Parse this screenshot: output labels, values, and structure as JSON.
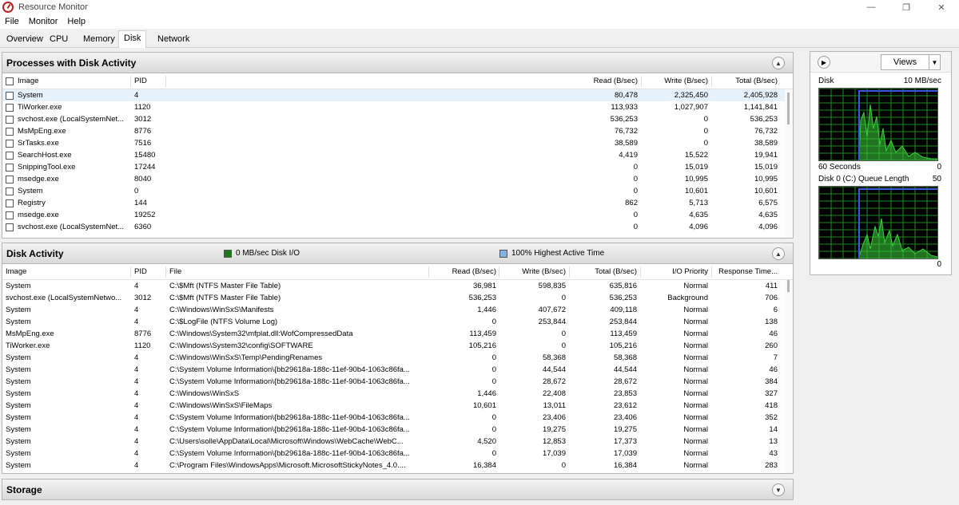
{
  "window": {
    "title": "Resource Monitor",
    "minimize_icon": "minimize-icon",
    "maximize_icon": "restore-icon"
  },
  "menu": {
    "file": "File",
    "monitor": "Monitor",
    "help": "Help"
  },
  "tabs": {
    "overview": "Overview",
    "cpu": "CPU",
    "memory": "Memory",
    "disk": "Disk",
    "network": "Network"
  },
  "processes": {
    "title": "Processes with Disk Activity",
    "headers": {
      "image": "Image",
      "pid": "PID",
      "read": "Read (B/sec)",
      "write": "Write (B/sec)",
      "total": "Total (B/sec)"
    },
    "rows": [
      {
        "image": "System",
        "pid": "4",
        "read": "80,478",
        "write": "2,325,450",
        "total": "2,405,928"
      },
      {
        "image": "TiWorker.exe",
        "pid": "1120",
        "read": "113,933",
        "write": "1,027,907",
        "total": "1,141,841"
      },
      {
        "image": "svchost.exe (LocalSystemNet...",
        "pid": "3012",
        "read": "536,253",
        "write": "0",
        "total": "536,253"
      },
      {
        "image": "MsMpEng.exe",
        "pid": "8776",
        "read": "76,732",
        "write": "0",
        "total": "76,732"
      },
      {
        "image": "SrTasks.exe",
        "pid": "7516",
        "read": "38,589",
        "write": "0",
        "total": "38,589"
      },
      {
        "image": "SearchHost.exe",
        "pid": "15480",
        "read": "4,419",
        "write": "15,522",
        "total": "19,941"
      },
      {
        "image": "SnippingTool.exe",
        "pid": "17244",
        "read": "0",
        "write": "15,019",
        "total": "15,019"
      },
      {
        "image": "msedge.exe",
        "pid": "8040",
        "read": "0",
        "write": "10,995",
        "total": "10,995"
      },
      {
        "image": "System",
        "pid": "0",
        "read": "0",
        "write": "10,601",
        "total": "10,601"
      },
      {
        "image": "Registry",
        "pid": "144",
        "read": "862",
        "write": "5,713",
        "total": "6,575"
      },
      {
        "image": "msedge.exe",
        "pid": "19252",
        "read": "0",
        "write": "4,635",
        "total": "4,635"
      },
      {
        "image": "svchost.exe (LocalSystemNet...",
        "pid": "6360",
        "read": "0",
        "write": "4,096",
        "total": "4,096"
      }
    ]
  },
  "disk_activity": {
    "title": "Disk Activity",
    "legend_io": "0 MB/sec Disk I/O",
    "legend_active": "100% Highest Active Time",
    "headers": {
      "image": "Image",
      "pid": "PID",
      "file": "File",
      "read": "Read (B/sec)",
      "write": "Write (B/sec)",
      "total": "Total (B/sec)",
      "priority": "I/O Priority",
      "response": "Response Time..."
    },
    "rows": [
      {
        "image": "System",
        "pid": "4",
        "file": "C:\\$Mft (NTFS Master File Table)",
        "read": "36,981",
        "write": "598,835",
        "total": "635,816",
        "priority": "Normal",
        "response": "411"
      },
      {
        "image": "svchost.exe (LocalSystemNetwo...",
        "pid": "3012",
        "file": "C:\\$Mft (NTFS Master File Table)",
        "read": "536,253",
        "write": "0",
        "total": "536,253",
        "priority": "Background",
        "response": "706"
      },
      {
        "image": "System",
        "pid": "4",
        "file": "C:\\Windows\\WinSxS\\Manifests",
        "read": "1,446",
        "write": "407,672",
        "total": "409,118",
        "priority": "Normal",
        "response": "6"
      },
      {
        "image": "System",
        "pid": "4",
        "file": "C:\\$LogFile (NTFS Volume Log)",
        "read": "0",
        "write": "253,844",
        "total": "253,844",
        "priority": "Normal",
        "response": "138"
      },
      {
        "image": "MsMpEng.exe",
        "pid": "8776",
        "file": "C:\\Windows\\System32\\mfplat.dll:WofCompressedData",
        "read": "113,459",
        "write": "0",
        "total": "113,459",
        "priority": "Normal",
        "response": "46"
      },
      {
        "image": "TiWorker.exe",
        "pid": "1120",
        "file": "C:\\Windows\\System32\\config\\SOFTWARE",
        "read": "105,216",
        "write": "0",
        "total": "105,216",
        "priority": "Normal",
        "response": "260"
      },
      {
        "image": "System",
        "pid": "4",
        "file": "C:\\Windows\\WinSxS\\Temp\\PendingRenames",
        "read": "0",
        "write": "58,368",
        "total": "58,368",
        "priority": "Normal",
        "response": "7"
      },
      {
        "image": "System",
        "pid": "4",
        "file": "C:\\System Volume Information\\{bb29618a-188c-11ef-90b4-1063c86fa...",
        "read": "0",
        "write": "44,544",
        "total": "44,544",
        "priority": "Normal",
        "response": "46"
      },
      {
        "image": "System",
        "pid": "4",
        "file": "C:\\System Volume Information\\{bb29618a-188c-11ef-90b4-1063c86fa...",
        "read": "0",
        "write": "28,672",
        "total": "28,672",
        "priority": "Normal",
        "response": "384"
      },
      {
        "image": "System",
        "pid": "4",
        "file": "C:\\Windows\\WinSxS",
        "read": "1,446",
        "write": "22,408",
        "total": "23,853",
        "priority": "Normal",
        "response": "327"
      },
      {
        "image": "System",
        "pid": "4",
        "file": "C:\\Windows\\WinSxS\\FileMaps",
        "read": "10,601",
        "write": "13,011",
        "total": "23,612",
        "priority": "Normal",
        "response": "418"
      },
      {
        "image": "System",
        "pid": "4",
        "file": "C:\\System Volume Information\\{bb29618a-188c-11ef-90b4-1063c86fa...",
        "read": "0",
        "write": "23,406",
        "total": "23,406",
        "priority": "Normal",
        "response": "352"
      },
      {
        "image": "System",
        "pid": "4",
        "file": "C:\\System Volume Information\\{bb29618a-188c-11ef-90b4-1063c86fa...",
        "read": "0",
        "write": "19,275",
        "total": "19,275",
        "priority": "Normal",
        "response": "14"
      },
      {
        "image": "System",
        "pid": "4",
        "file": "C:\\Users\\solle\\AppData\\Local\\Microsoft\\Windows\\WebCache\\WebC...",
        "read": "4,520",
        "write": "12,853",
        "total": "17,373",
        "priority": "Normal",
        "response": "13"
      },
      {
        "image": "System",
        "pid": "4",
        "file": "C:\\System Volume Information\\{bb29618a-188c-11ef-90b4-1063c86fa...",
        "read": "0",
        "write": "17,039",
        "total": "17,039",
        "priority": "Normal",
        "response": "43"
      },
      {
        "image": "System",
        "pid": "4",
        "file": "C:\\Program Files\\WindowsApps\\Microsoft.MicrosoftStickyNotes_4.0....",
        "read": "16,384",
        "write": "0",
        "total": "16,384",
        "priority": "Normal",
        "response": "283"
      }
    ]
  },
  "storage": {
    "title": "Storage"
  },
  "side": {
    "views_label": "Views",
    "disk_label": "Disk",
    "disk_max": "10 MB/sec",
    "disk_min": "0",
    "time_label": "60 Seconds",
    "queue_label": "Disk 0 (C:) Queue Length",
    "queue_max": "50",
    "queue_min": "0"
  },
  "colors": {
    "io_swatch": "#1a7a1a",
    "active_swatch": "#7fb3e6",
    "graph_bg": "#000000",
    "graph_grid": "#1e8a1e",
    "graph_line": "#3cd23c",
    "graph_blue": "#3a5bd9"
  }
}
